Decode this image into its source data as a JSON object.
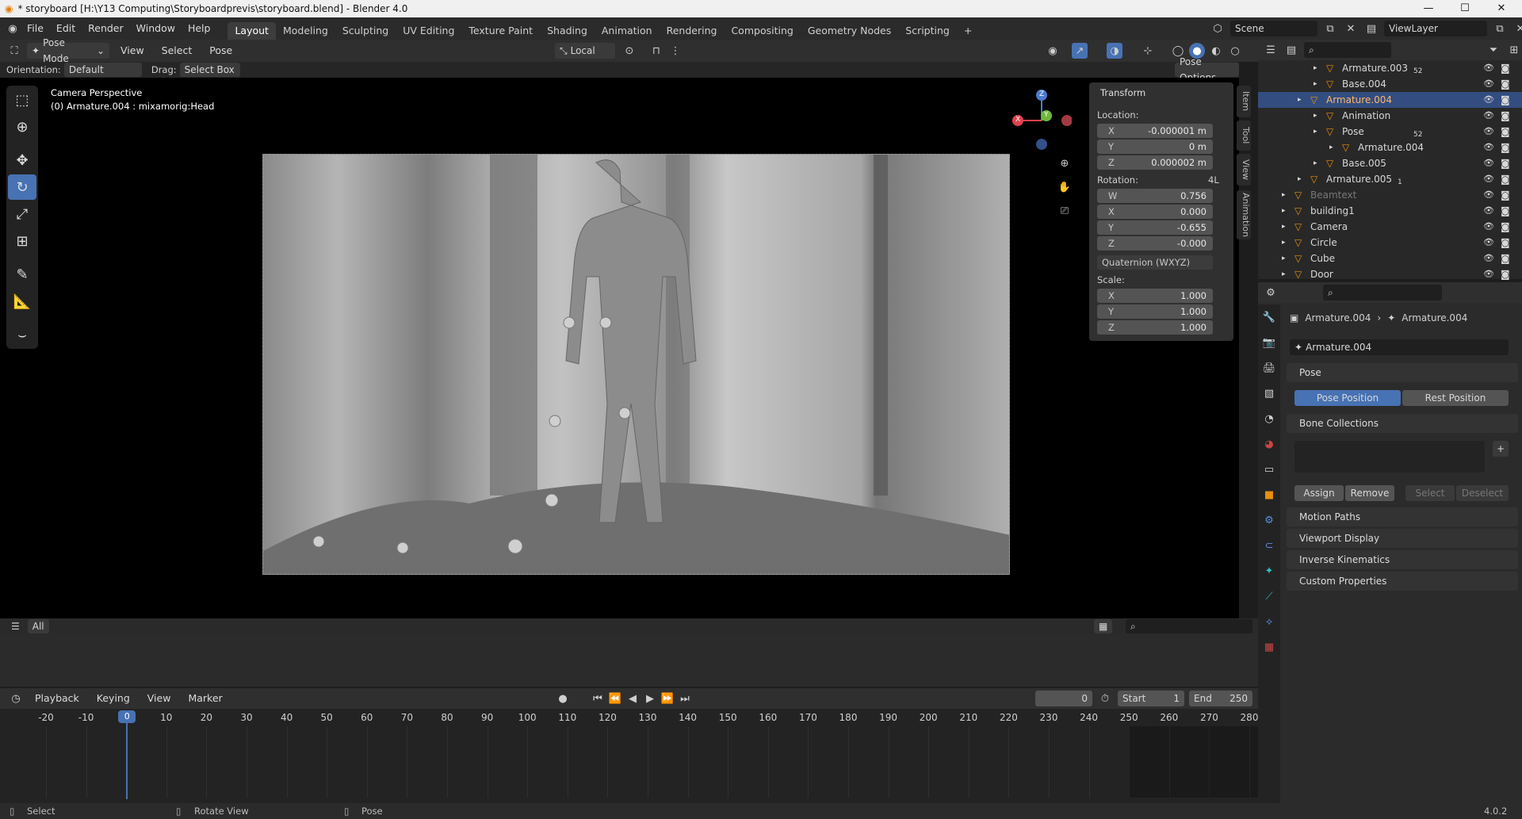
{
  "window": {
    "title": "* storyboard [H:\\Y13 Computing\\Storyboardprevis\\storyboard.blend] - Blender 4.0",
    "min": "—",
    "max": "☐",
    "close": "✕"
  },
  "menu": [
    "File",
    "Edit",
    "Render",
    "Window",
    "Help"
  ],
  "workspaces": [
    "Layout",
    "Modeling",
    "Sculpting",
    "UV Editing",
    "Texture Paint",
    "Shading",
    "Animation",
    "Rendering",
    "Compositing",
    "Geometry Nodes",
    "Scripting"
  ],
  "scene": {
    "name": "Scene",
    "view_layer": "ViewLayer"
  },
  "viewport_header": {
    "mode": "Pose Mode",
    "view": "View",
    "select": "Select",
    "pose": "Pose",
    "transform": "Local",
    "orientation_label": "Orientation:",
    "orientation": "Default",
    "drag_label": "Drag:",
    "drag": "Select Box",
    "pose_options": "Pose Options"
  },
  "viewport": {
    "camera_label": "Camera Perspective",
    "active": "(0) Armature.004 : mixamorig:Head",
    "axis_x": "X",
    "axis_y": "Y",
    "axis_z": "Z"
  },
  "npanel": {
    "title": "Transform",
    "location_label": "Location:",
    "loc": [
      {
        "k": "X",
        "v": "-0.000001 m"
      },
      {
        "k": "Y",
        "v": "0 m"
      },
      {
        "k": "Z",
        "v": "0.000002 m"
      }
    ],
    "rotation_label": "Rotation:",
    "rot_mode_short": "4L",
    "rot": [
      {
        "k": "W",
        "v": "0.756"
      },
      {
        "k": "X",
        "v": "0.000"
      },
      {
        "k": "Y",
        "v": "-0.655"
      },
      {
        "k": "Z",
        "v": "-0.000"
      }
    ],
    "rot_mode": "Quaternion (WXYZ)",
    "scale_label": "Scale:",
    "scale": [
      {
        "k": "X",
        "v": "1.000"
      },
      {
        "k": "Y",
        "v": "1.000"
      },
      {
        "k": "Z",
        "v": "1.000"
      }
    ],
    "tabs": [
      "Item",
      "Tool",
      "View",
      "Animation"
    ]
  },
  "outliner": {
    "rows": [
      {
        "name": "Armature.003",
        "badge": "52",
        "indent": 3,
        "sel": false
      },
      {
        "name": "Base.004",
        "indent": 3,
        "sel": false
      },
      {
        "name": "Armature.004",
        "indent": 2,
        "sel": true
      },
      {
        "name": "Animation",
        "indent": 3,
        "sel": false
      },
      {
        "name": "Pose",
        "badge": "52",
        "indent": 3,
        "sel": false
      },
      {
        "name": "Armature.004",
        "indent": 4,
        "sel": false
      },
      {
        "name": "Base.005",
        "indent": 3,
        "sel": false
      },
      {
        "name": "Armature.005",
        "badge": "1",
        "indent": 2,
        "sel": false
      },
      {
        "name": "Beamtext",
        "indent": 1,
        "sel": false,
        "dim": true
      },
      {
        "name": "building1",
        "indent": 1,
        "sel": false
      },
      {
        "name": "Camera",
        "indent": 1,
        "sel": false
      },
      {
        "name": "Circle",
        "indent": 1,
        "sel": false
      },
      {
        "name": "Cube",
        "indent": 1,
        "sel": false
      },
      {
        "name": "Door",
        "indent": 1,
        "sel": false
      }
    ]
  },
  "props": {
    "crumb_a": "Armature.004",
    "crumb_b": "Armature.004",
    "data_name": "Armature.004",
    "pose_section": "Pose",
    "pose_position": "Pose Position",
    "rest_position": "Rest Position",
    "bone_collections": "Bone Collections",
    "assign": "Assign",
    "remove": "Remove",
    "select": "Select",
    "deselect": "Deselect",
    "sections": [
      "Motion Paths",
      "Viewport Display",
      "Inverse Kinematics",
      "Custom Properties"
    ]
  },
  "dopesheet": {
    "filter": "All"
  },
  "timeline": {
    "playback": "Playback",
    "keying": "Keying",
    "view": "View",
    "marker": "Marker",
    "current": "0",
    "start_label": "Start",
    "start": "1",
    "end_label": "End",
    "end": "250",
    "ruler": [
      "-20",
      "-10",
      "0",
      "10",
      "20",
      "30",
      "40",
      "50",
      "60",
      "70",
      "80",
      "90",
      "100",
      "110",
      "120",
      "130",
      "140",
      "150",
      "160",
      "170",
      "180",
      "190",
      "200",
      "210",
      "220",
      "230",
      "240",
      "250",
      "260",
      "270",
      "280"
    ]
  },
  "status": {
    "select": "Select",
    "rotate": "Rotate View",
    "pose": "Pose",
    "version": "4.0.2"
  },
  "colors": {
    "accent": "#4772b3",
    "selected_row": "#334d80",
    "viewport_bg": "#000000",
    "playhead": "#4772b3"
  }
}
